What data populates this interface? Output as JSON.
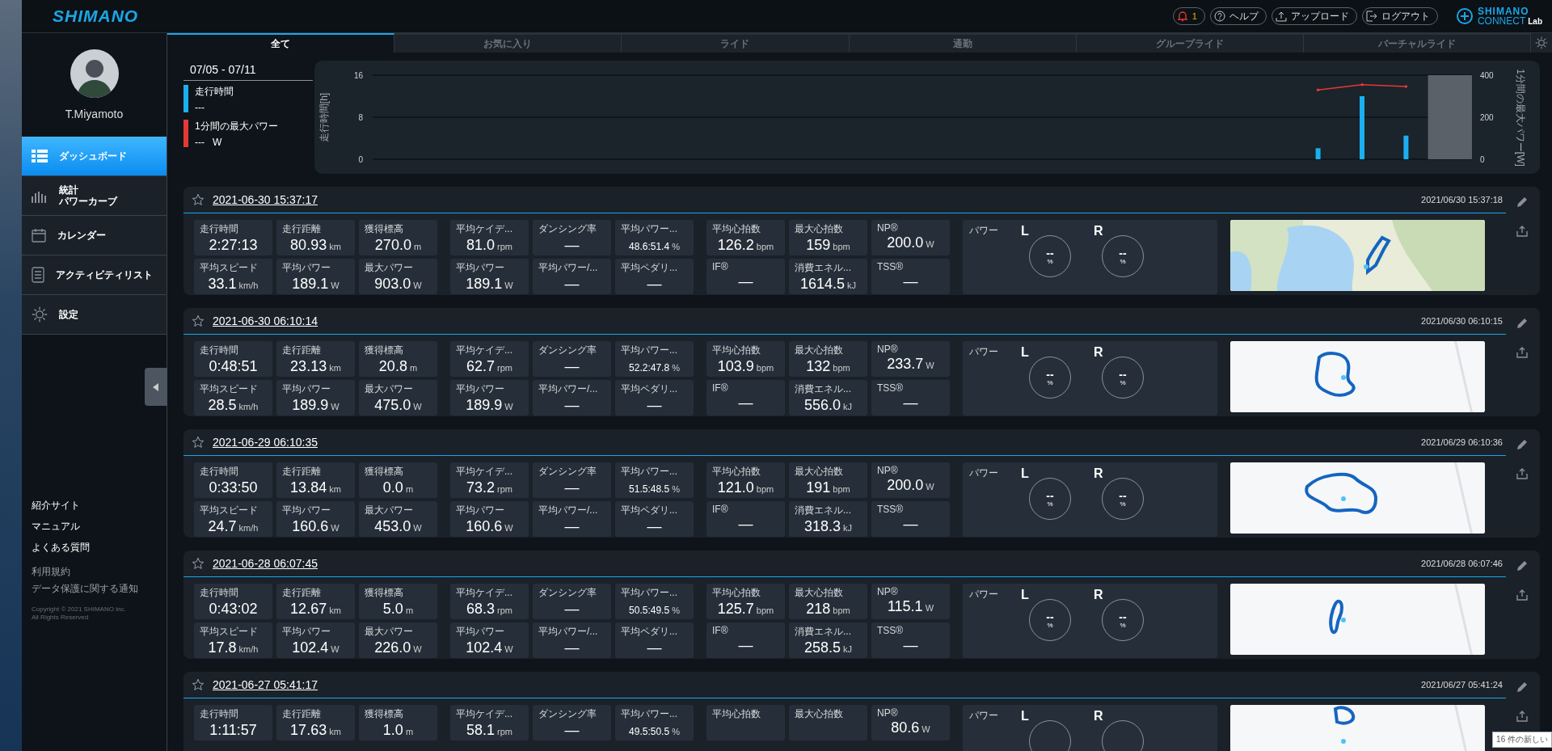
{
  "header": {
    "logo": "SHIMANO",
    "notifications": {
      "count": "1"
    },
    "buttons": [
      {
        "kind": "help",
        "label": "ヘルプ"
      },
      {
        "kind": "upload",
        "label": "アップロード"
      },
      {
        "kind": "logout",
        "label": "ログアウト"
      }
    ],
    "brand": {
      "name": "SHIMANO",
      "product": "CONNECT",
      "suffix": "Lab"
    }
  },
  "sidebar": {
    "user": {
      "name": "T.Miyamoto"
    },
    "nav": [
      {
        "kind": "dashboard",
        "lines": [
          "ダッシュボード"
        ],
        "selected": true
      },
      {
        "kind": "stats",
        "lines": [
          "統計",
          "パワーカーブ"
        ],
        "selected": false
      },
      {
        "kind": "calendar",
        "lines": [
          "カレンダー"
        ],
        "selected": false
      },
      {
        "kind": "list",
        "lines": [
          "アクティビティリスト"
        ],
        "selected": false
      },
      {
        "kind": "settings",
        "lines": [
          "設定"
        ],
        "selected": false
      }
    ],
    "links": [
      "紹介サイト",
      "マニュアル",
      "よくある質問"
    ],
    "legal": [
      "利用規約",
      "データ保護に関する通知"
    ],
    "copyright": [
      "Copyright © 2021 SHIMANO inc.",
      "All Rights Reserved"
    ]
  },
  "tabs": [
    {
      "label": "全て",
      "selected": true
    },
    {
      "label": "お気に入り",
      "selected": false
    },
    {
      "label": "ライド",
      "selected": false
    },
    {
      "label": "通勤",
      "selected": false
    },
    {
      "label": "グループライド",
      "selected": false
    },
    {
      "label": "バーチャルライド",
      "selected": false
    }
  ],
  "summary": {
    "range": "07/05 - 07/11",
    "legend": [
      {
        "label": "走行時間",
        "value": "---",
        "color": "#1ab0f0"
      },
      {
        "label": "1分間の最大パワー",
        "value": "---",
        "unit": "W",
        "color": "#e53935"
      }
    ],
    "chart_data": {
      "type": "bar",
      "ylabel": "走行時間[h]",
      "ylim": [
        0,
        16
      ],
      "yticks": [
        0,
        8,
        16
      ],
      "y2label": "1分間の最大パワー[W]",
      "y2lim": [
        0,
        400
      ],
      "y2ticks": [
        0,
        200,
        400
      ],
      "series": [
        {
          "color": "#5b6168",
          "type": "bar",
          "values": [
            null,
            null,
            null,
            null,
            null,
            null,
            null,
            null,
            null,
            null,
            null,
            null,
            null,
            null,
            null,
            null,
            null,
            null,
            null,
            null,
            null,
            null,
            null,
            null,
            16
          ]
        },
        {
          "color": "#1ab0f0",
          "values": [
            null,
            null,
            null,
            null,
            null,
            null,
            null,
            null,
            null,
            null,
            null,
            null,
            null,
            null,
            null,
            null,
            null,
            null,
            null,
            null,
            null,
            2.1,
            12.0,
            4.5,
            null
          ]
        },
        {
          "color": "#e53935",
          "axis": "y2",
          "type": "line",
          "values": [
            null,
            null,
            null,
            null,
            null,
            null,
            null,
            null,
            null,
            null,
            null,
            null,
            null,
            null,
            null,
            null,
            null,
            null,
            null,
            null,
            null,
            330,
            355,
            346,
            null
          ]
        }
      ],
      "stacked": false
    }
  },
  "activities": [
    {
      "title": "2021-06-30 15:37:17",
      "favorite": false,
      "recorded": "2021/06/30 15:37:18",
      "stats": [
        [
          {
            "label": "走行時間",
            "value": "2:27:13"
          },
          {
            "label": "走行距離",
            "value": "80.93",
            "unit": "km"
          },
          {
            "label": "獲得標高",
            "value": "270.0",
            "unit": "m"
          },
          {
            "label": "平均スピード",
            "value": "33.1",
            "unit": "km/h"
          },
          {
            "label": "平均パワー",
            "value": "189.1",
            "unit": "W"
          },
          {
            "label": "最大パワー",
            "value": "903.0",
            "unit": "W"
          }
        ],
        [
          {
            "label": "平均ケイデ...",
            "value": "81.0",
            "unit": "rpm"
          },
          {
            "label": "ダンシング率",
            "value": "—"
          },
          {
            "label": "平均パワー...",
            "value": "48.6:51.4",
            "unit": "%",
            "small": true
          },
          {
            "label": "平均パワー",
            "value": "189.1",
            "unit": "W"
          },
          {
            "label": "平均パワー/...",
            "value": "—"
          },
          {
            "label": "平均ペダリ...",
            "value": "—"
          }
        ],
        [
          {
            "label": "平均心拍数",
            "value": "126.2",
            "unit": "bpm"
          },
          {
            "label": "最大心拍数",
            "value": "159",
            "unit": "bpm"
          },
          {
            "label": "NP®",
            "value": "200.0",
            "unit": "W"
          },
          {
            "label": "IF®",
            "value": "—"
          },
          {
            "label": "消費エネル...",
            "value": "1614.5",
            "unit": "kJ"
          },
          {
            "label": "TSS®",
            "value": "—"
          }
        ]
      ],
      "power": {
        "label": "パワー",
        "sides": [
          {
            "side": "L",
            "value": "--",
            "unit": "%"
          },
          {
            "side": "R",
            "value": "--",
            "unit": "%"
          }
        ]
      }
    },
    {
      "title": "2021-06-30 06:10:14",
      "favorite": false,
      "recorded": "2021/06/30 06:10:15",
      "stats": [
        [
          {
            "label": "走行時間",
            "value": "0:48:51"
          },
          {
            "label": "走行距離",
            "value": "23.13",
            "unit": "km"
          },
          {
            "label": "獲得標高",
            "value": "20.8",
            "unit": "m"
          },
          {
            "label": "平均スピード",
            "value": "28.5",
            "unit": "km/h"
          },
          {
            "label": "平均パワー",
            "value": "189.9",
            "unit": "W"
          },
          {
            "label": "最大パワー",
            "value": "475.0",
            "unit": "W"
          }
        ],
        [
          {
            "label": "平均ケイデ...",
            "value": "62.7",
            "unit": "rpm"
          },
          {
            "label": "ダンシング率",
            "value": "—"
          },
          {
            "label": "平均パワー...",
            "value": "52.2:47.8",
            "unit": "%",
            "small": true
          },
          {
            "label": "平均パワー",
            "value": "189.9",
            "unit": "W"
          },
          {
            "label": "平均パワー/...",
            "value": "—"
          },
          {
            "label": "平均ペダリ...",
            "value": "—"
          }
        ],
        [
          {
            "label": "平均心拍数",
            "value": "103.9",
            "unit": "bpm"
          },
          {
            "label": "最大心拍数",
            "value": "132",
            "unit": "bpm"
          },
          {
            "label": "NP®",
            "value": "233.7",
            "unit": "W"
          },
          {
            "label": "IF®",
            "value": "—"
          },
          {
            "label": "消費エネル...",
            "value": "556.0",
            "unit": "kJ"
          },
          {
            "label": "TSS®",
            "value": "—"
          }
        ]
      ],
      "power": {
        "label": "パワー",
        "sides": [
          {
            "side": "L",
            "value": "--",
            "unit": "%"
          },
          {
            "side": "R",
            "value": "--",
            "unit": "%"
          }
        ]
      }
    },
    {
      "title": "2021-06-29 06:10:35",
      "favorite": false,
      "recorded": "2021/06/29 06:10:36",
      "stats": [
        [
          {
            "label": "走行時間",
            "value": "0:33:50"
          },
          {
            "label": "走行距離",
            "value": "13.84",
            "unit": "km"
          },
          {
            "label": "獲得標高",
            "value": "0.0",
            "unit": "m"
          },
          {
            "label": "平均スピード",
            "value": "24.7",
            "unit": "km/h"
          },
          {
            "label": "平均パワー",
            "value": "160.6",
            "unit": "W"
          },
          {
            "label": "最大パワー",
            "value": "453.0",
            "unit": "W"
          }
        ],
        [
          {
            "label": "平均ケイデ...",
            "value": "73.2",
            "unit": "rpm"
          },
          {
            "label": "ダンシング率",
            "value": "—"
          },
          {
            "label": "平均パワー...",
            "value": "51.5:48.5",
            "unit": "%",
            "small": true
          },
          {
            "label": "平均パワー",
            "value": "160.6",
            "unit": "W"
          },
          {
            "label": "平均パワー/...",
            "value": "—"
          },
          {
            "label": "平均ペダリ...",
            "value": "—"
          }
        ],
        [
          {
            "label": "平均心拍数",
            "value": "121.0",
            "unit": "bpm"
          },
          {
            "label": "最大心拍数",
            "value": "191",
            "unit": "bpm"
          },
          {
            "label": "NP®",
            "value": "200.0",
            "unit": "W"
          },
          {
            "label": "IF®",
            "value": "—"
          },
          {
            "label": "消費エネル...",
            "value": "318.3",
            "unit": "kJ"
          },
          {
            "label": "TSS®",
            "value": "—"
          }
        ]
      ],
      "power": {
        "label": "パワー",
        "sides": [
          {
            "side": "L",
            "value": "--",
            "unit": "%"
          },
          {
            "side": "R",
            "value": "--",
            "unit": "%"
          }
        ]
      }
    },
    {
      "title": "2021-06-28 06:07:45",
      "favorite": false,
      "recorded": "2021/06/28 06:07:46",
      "stats": [
        [
          {
            "label": "走行時間",
            "value": "0:43:02"
          },
          {
            "label": "走行距離",
            "value": "12.67",
            "unit": "km"
          },
          {
            "label": "獲得標高",
            "value": "5.0",
            "unit": "m"
          },
          {
            "label": "平均スピード",
            "value": "17.8",
            "unit": "km/h"
          },
          {
            "label": "平均パワー",
            "value": "102.4",
            "unit": "W"
          },
          {
            "label": "最大パワー",
            "value": "226.0",
            "unit": "W"
          }
        ],
        [
          {
            "label": "平均ケイデ...",
            "value": "68.3",
            "unit": "rpm"
          },
          {
            "label": "ダンシング率",
            "value": "—"
          },
          {
            "label": "平均パワー...",
            "value": "50.5:49.5",
            "unit": "%",
            "small": true
          },
          {
            "label": "平均パワー",
            "value": "102.4",
            "unit": "W"
          },
          {
            "label": "平均パワー/...",
            "value": "—"
          },
          {
            "label": "平均ペダリ...",
            "value": "—"
          }
        ],
        [
          {
            "label": "平均心拍数",
            "value": "125.7",
            "unit": "bpm"
          },
          {
            "label": "最大心拍数",
            "value": "218",
            "unit": "bpm"
          },
          {
            "label": "NP®",
            "value": "115.1",
            "unit": "W"
          },
          {
            "label": "IF®",
            "value": "—"
          },
          {
            "label": "消費エネル...",
            "value": "258.5",
            "unit": "kJ"
          },
          {
            "label": "TSS®",
            "value": "—"
          }
        ]
      ],
      "power": {
        "label": "パワー",
        "sides": [
          {
            "side": "L",
            "value": "--",
            "unit": "%"
          },
          {
            "side": "R",
            "value": "--",
            "unit": "%"
          }
        ]
      }
    },
    {
      "title": "2021-06-27 05:41:17",
      "favorite": false,
      "recorded": "2021/06/27 05:41:24",
      "stats": [
        [
          {
            "label": "走行時間",
            "value": "1:11:57"
          },
          {
            "label": "走行距離",
            "value": "17.63",
            "unit": "km"
          },
          {
            "label": "獲得標高",
            "value": "1.0",
            "unit": "m"
          }
        ],
        [
          {
            "label": "平均ケイデ...",
            "value": "58.1",
            "unit": "rpm"
          },
          {
            "label": "ダンシング率",
            "value": "—"
          },
          {
            "label": "平均パワー...",
            "value": "49.5:50.5",
            "unit": "%",
            "small": true
          }
        ],
        [
          {
            "label": "平均心拍数"
          },
          {
            "label": "最大心拍数"
          },
          {
            "label": "NP®",
            "value": "80.6",
            "unit": "W"
          }
        ]
      ],
      "power": {
        "label": "パワー",
        "sides": [
          {
            "side": "L"
          },
          {
            "side": "R"
          }
        ]
      }
    }
  ],
  "toast": "16 件の新しい"
}
